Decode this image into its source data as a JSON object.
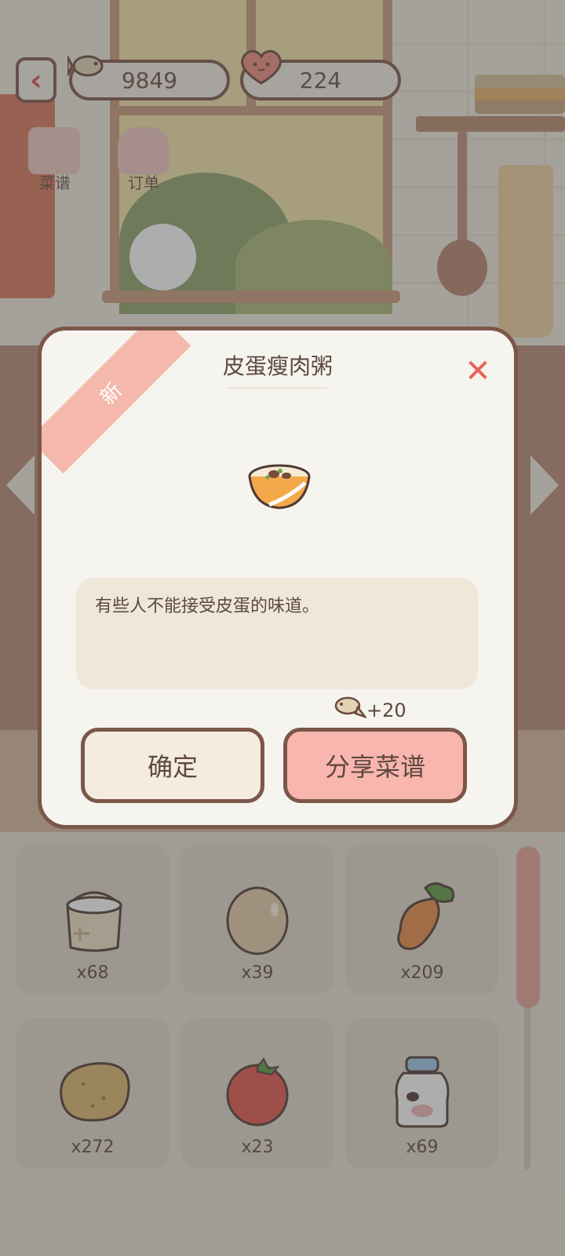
{
  "hud": {
    "currency_coins": "9849",
    "currency_hearts": "224",
    "menu_recipes_label": "菜谱",
    "menu_orders_label": "订单"
  },
  "dialog": {
    "ribbon_label": "新",
    "dish_name": "皮蛋瘦肉粥",
    "description": "有些人不能接受皮蛋的味道。",
    "reward_text": "+20",
    "confirm_label": "确定",
    "share_label": "分享菜谱"
  },
  "ingredients": [
    {
      "icon": "flour-sack-icon",
      "count": "x68"
    },
    {
      "icon": "egg-icon",
      "count": "x39"
    },
    {
      "icon": "carrot-icon",
      "count": "x209"
    },
    {
      "icon": "potato-icon",
      "count": "x272"
    },
    {
      "icon": "tomato-icon",
      "count": "x23"
    },
    {
      "icon": "milk-bottle-icon",
      "count": "x69"
    }
  ],
  "colors": {
    "accent_pink": "#f8b6ae",
    "outline_brown": "#7b5749",
    "close_red": "#e8625a",
    "panel_cream": "#f6f4ee"
  }
}
